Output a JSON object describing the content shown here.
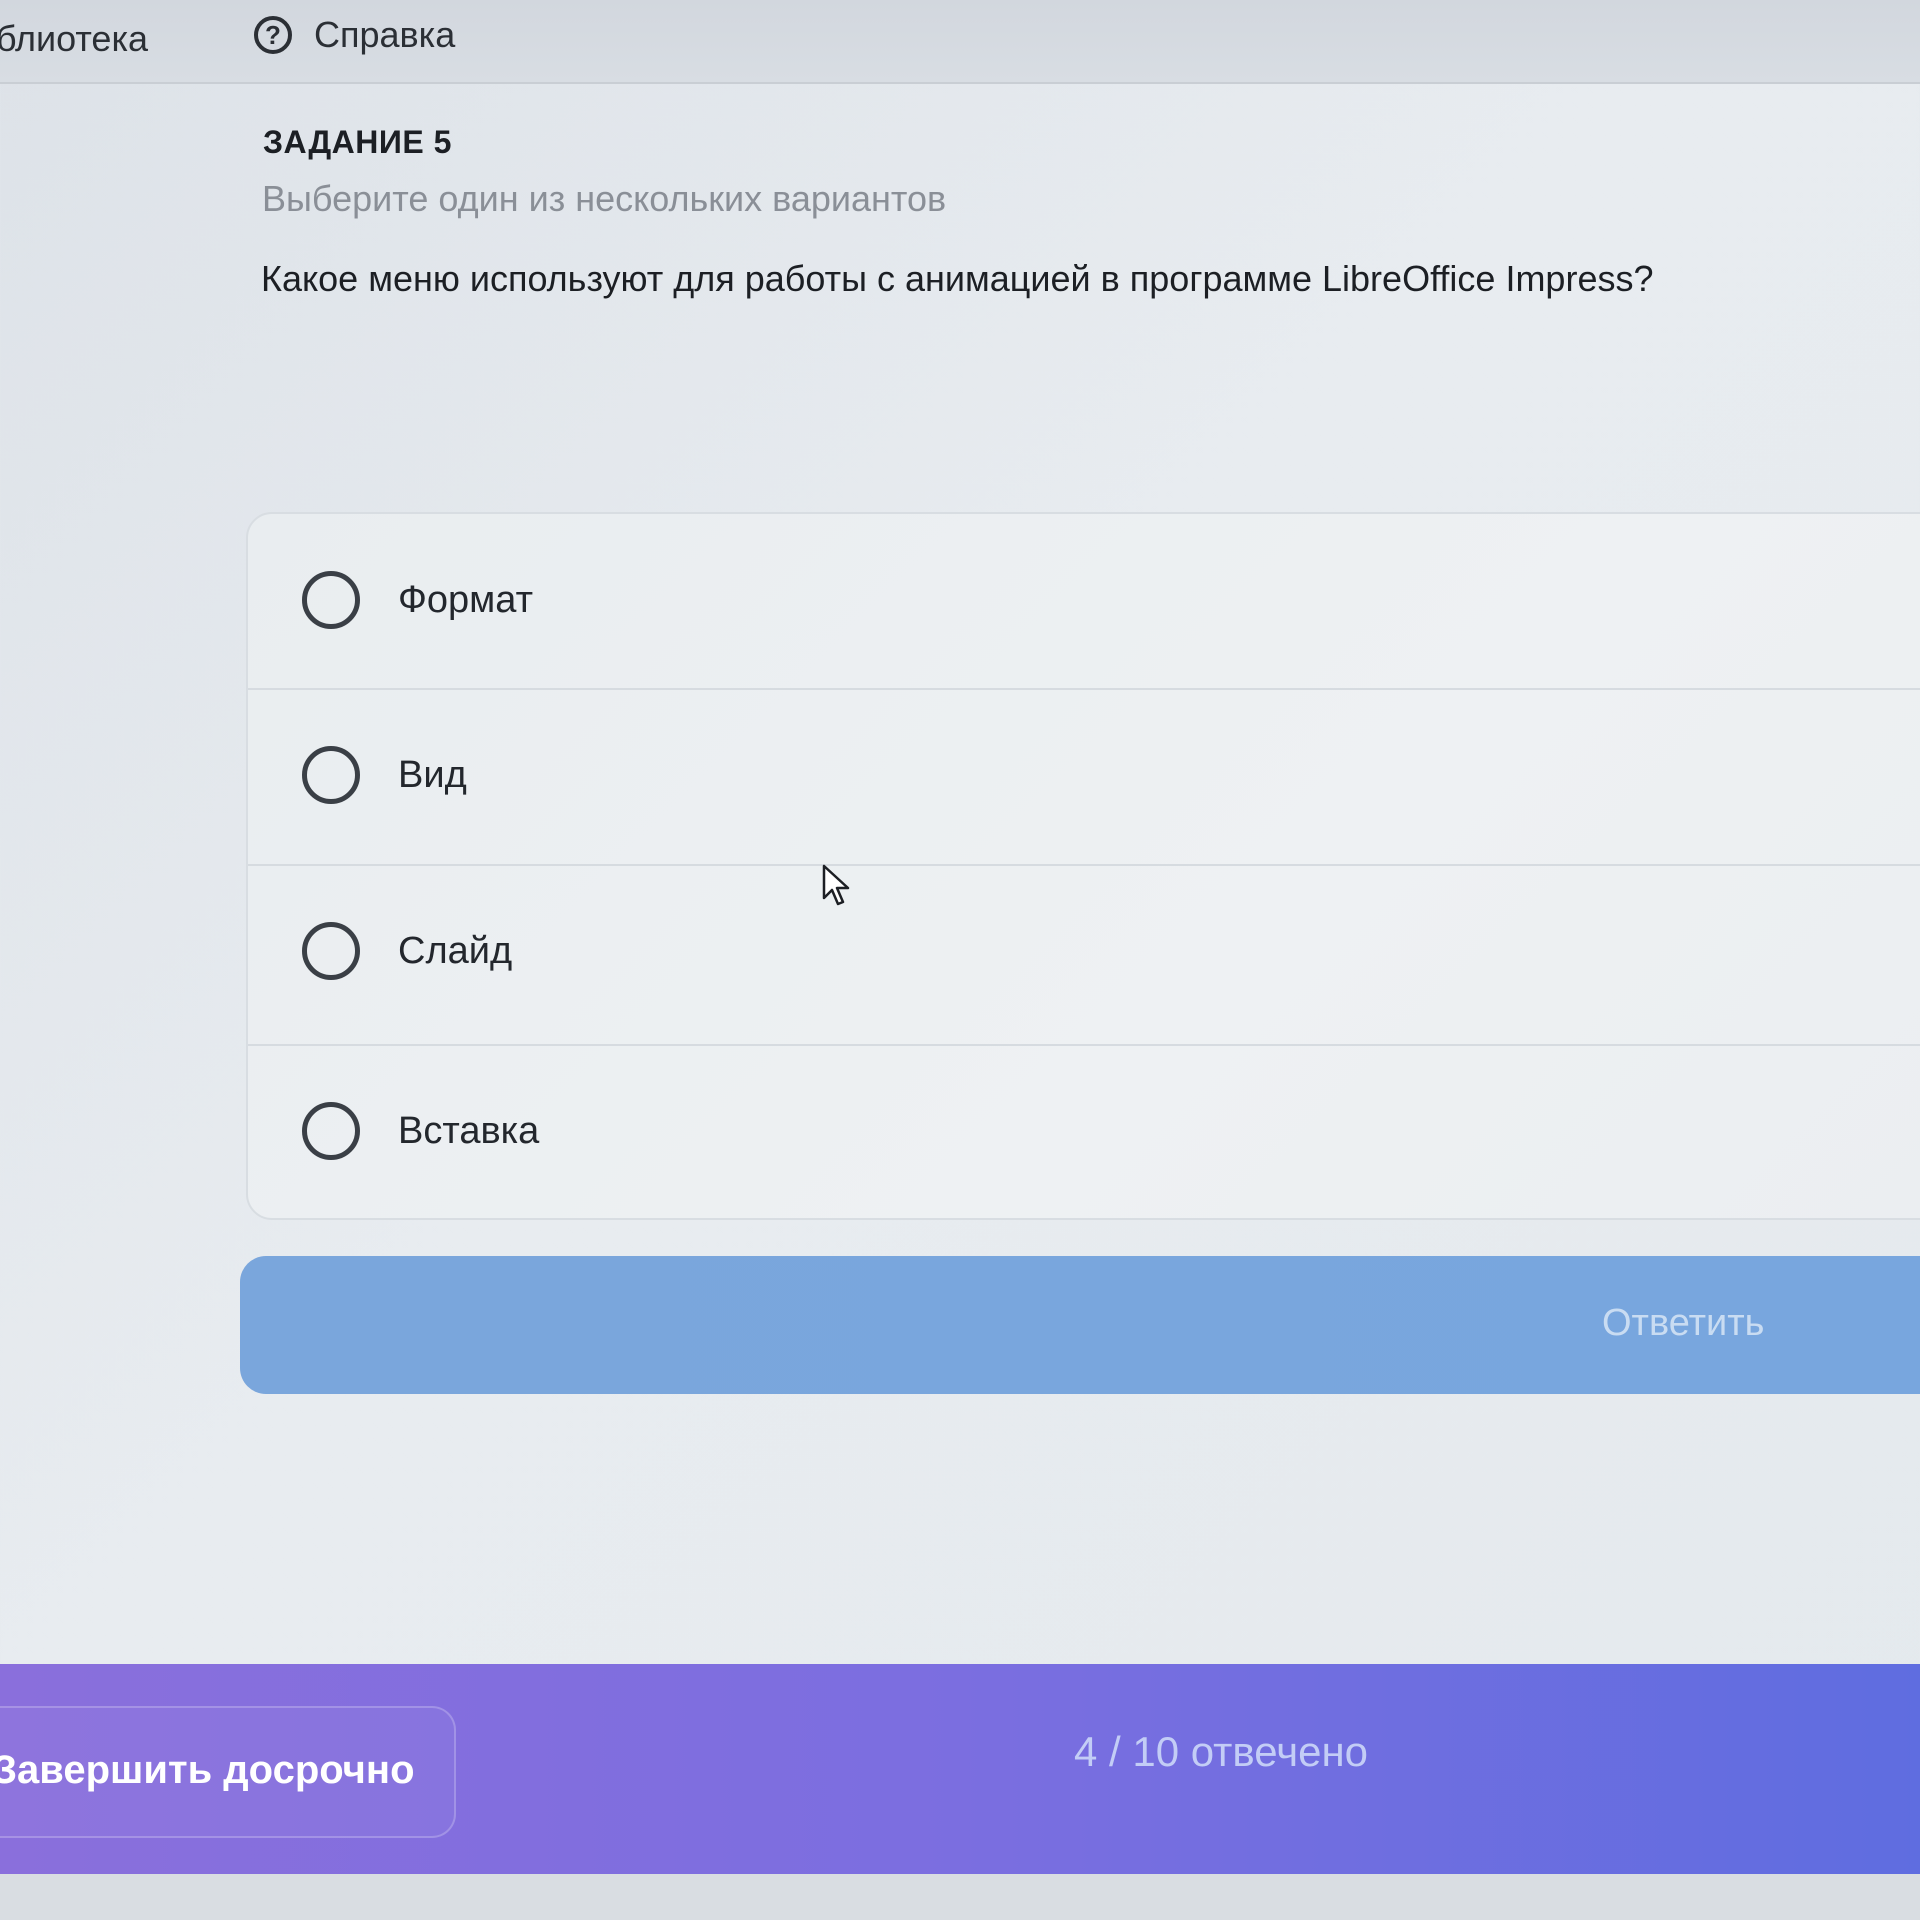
{
  "topbar": {
    "library_label": "блиотека",
    "help_label": "Справка",
    "help_icon_glyph": "?"
  },
  "task": {
    "number_label": "ЗАДАНИЕ 5",
    "instruction": "Выберите один из нескольких вариантов",
    "question": "Какое меню используют для работы с анимацией в программе LibreOffice Impress?"
  },
  "options": [
    {
      "label": "Формат",
      "selected": false
    },
    {
      "label": "Вид",
      "selected": false
    },
    {
      "label": "Слайд",
      "selected": false
    },
    {
      "label": "Вставка",
      "selected": false
    }
  ],
  "answer_button": {
    "label": "Ответить"
  },
  "bottombar": {
    "finish_label": "Завершить досрочно",
    "progress_text": "4 / 10 отвечено"
  },
  "colors": {
    "accent_button": "#7aa6dc",
    "bottombar_start": "#8a6fdc",
    "bottombar_end": "#5f6de0"
  }
}
